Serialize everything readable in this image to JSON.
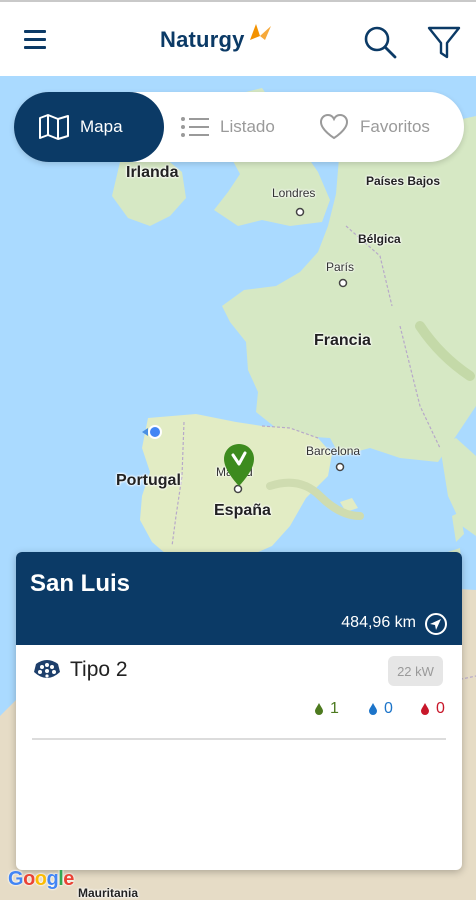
{
  "header": {
    "brand": "Naturgy"
  },
  "view_tabs": [
    {
      "label": "Mapa",
      "active": true
    },
    {
      "label": "Listado",
      "active": false
    },
    {
      "label": "Favoritos",
      "active": false
    }
  ],
  "map": {
    "labels": {
      "irlanda": "Irlanda",
      "londres": "Londres",
      "paises_bajos": "Países Bajos",
      "belgica": "Bélgica",
      "paris": "París",
      "francia": "Francia",
      "portugal": "Portugal",
      "madrid": "Madrid",
      "espana": "España",
      "barcelona": "Barcelona",
      "mauritania": "Mauritania"
    },
    "attribution": "Google"
  },
  "station_card": {
    "name": "San Luis",
    "distance": "484,96 km",
    "connector": {
      "type": "Tipo 2",
      "power": "22 kW"
    },
    "availability": {
      "available": "1",
      "occupied": "0",
      "out_of_service": "0"
    }
  },
  "colors": {
    "brand_navy": "#0b3a66",
    "brand_orange": "#f39200",
    "available_green": "#4d7a1f",
    "occupied_blue": "#1c74c9",
    "out_of_service_red": "#c8172a"
  }
}
